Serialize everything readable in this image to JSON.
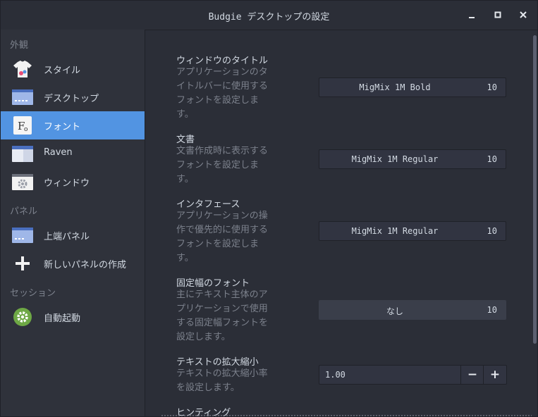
{
  "window": {
    "title": "Budgie デスクトップの設定",
    "minimize_icon": "minimize-icon",
    "maximize_icon": "maximize-icon",
    "close_icon": "close-icon"
  },
  "sidebar": {
    "sections": [
      "外観",
      "パネル",
      "セッション"
    ],
    "items": [
      {
        "label": "スタイル",
        "icon": "tshirt-icon"
      },
      {
        "label": "デスクトップ",
        "icon": "desktop-icon"
      },
      {
        "label": "フォント",
        "icon": "font-icon",
        "active": true
      },
      {
        "label": "Raven",
        "icon": "raven-icon"
      },
      {
        "label": "ウィンドウ",
        "icon": "window-gear-icon"
      },
      {
        "label": "上端パネル",
        "icon": "panel-icon"
      },
      {
        "label": "新しいパネルの作成",
        "icon": "plus-icon"
      },
      {
        "label": "自動起動",
        "icon": "autostart-gear-icon"
      }
    ],
    "accent_color": "#5294e2"
  },
  "settings": [
    {
      "title": "ウィンドウのタイトル",
      "desc": [
        "アプリケーションのタ",
        "イトルバーに使用する",
        "フォントを設定しま",
        "す。"
      ],
      "font": "MigMix 1M Bold",
      "size": "10"
    },
    {
      "title": "文書",
      "desc": [
        "文書作成時に表示する",
        "フォントを設定しま",
        "す。"
      ],
      "font": "MigMix 1M Regular",
      "size": "10"
    },
    {
      "title": "インタフェース",
      "desc": [
        "アプリケーションの操",
        "作で優先的に使用する",
        "フォントを設定しま",
        "す。"
      ],
      "font": "MigMix 1M Regular",
      "size": "10"
    },
    {
      "title": "固定幅のフォント",
      "desc": [
        "主にテキスト主体のア",
        "プリケーションで使用",
        "する固定幅フォントを",
        "設定します。"
      ],
      "font": "なし",
      "size": "10"
    },
    {
      "title": "テキストの拡大縮小",
      "desc": [
        "テキストの拡大縮小率",
        "を設定します。"
      ],
      "value": "1.00",
      "minus": "−",
      "plus": "+"
    },
    {
      "title": "ヒンティング"
    }
  ]
}
